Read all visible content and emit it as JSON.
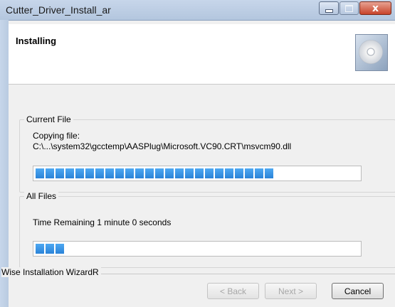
{
  "window": {
    "title": "Cutter_Driver_Install_ar",
    "controls": {
      "minimize_icon": "minimize-icon",
      "maximize_icon": "maximize-icon",
      "close_glyph": "x"
    }
  },
  "header": {
    "title": "Installing",
    "icon": "cd-disc-icon"
  },
  "current_file": {
    "legend": "Current File",
    "line1": "Copying file:",
    "line2": "C:\\...\\system32\\gcctemp\\AASPlug\\Microsoft.VC90.CRT\\msvcm90.dll",
    "progress": 0.74
  },
  "all_files": {
    "legend": "All Files",
    "status": "Time Remaining 1 minute  0 seconds",
    "progress": 0.1
  },
  "footer": {
    "wizard_label": "Wise Installation WizardR",
    "back_label": "< Back",
    "next_label": "Next >",
    "cancel_label": "Cancel"
  },
  "colors": {
    "progress_fill": "#2a83d8",
    "title_bar": "#c7d6ea",
    "close_button": "#c7432a"
  }
}
